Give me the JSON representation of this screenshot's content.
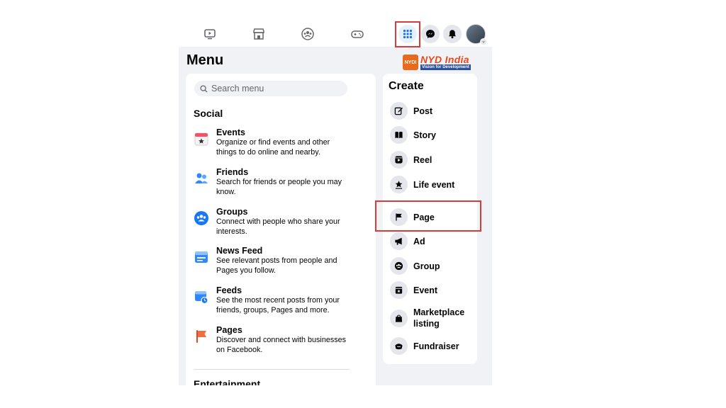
{
  "colors": {
    "accent": "#1877f2",
    "highlight": "#d93a3a",
    "background": "#f0f2f5"
  },
  "topbar": {
    "icons": [
      "watch-icon",
      "marketplace-icon",
      "groups-icon",
      "gaming-icon",
      "menu-grid-icon",
      "messenger-icon",
      "notifications-icon"
    ]
  },
  "logo": {
    "badge": "NYDI",
    "main": "NYD India",
    "sub": "Vision for Development"
  },
  "menu": {
    "title": "Menu",
    "search_placeholder": "Search menu",
    "social_title": "Social",
    "items": [
      {
        "label": "Events",
        "desc": "Organize or find events and other things to do online and nearby.",
        "icon": "events-icon"
      },
      {
        "label": "Friends",
        "desc": "Search for friends or people you may know.",
        "icon": "friends-icon"
      },
      {
        "label": "Groups",
        "desc": "Connect with people who share your interests.",
        "icon": "groups-icon"
      },
      {
        "label": "News Feed",
        "desc": "See relevant posts from people and Pages you follow.",
        "icon": "news-feed-icon"
      },
      {
        "label": "Feeds",
        "desc": "See the most recent posts from your friends, groups, Pages and more.",
        "icon": "feeds-icon"
      },
      {
        "label": "Pages",
        "desc": "Discover and connect with businesses on Facebook.",
        "icon": "pages-flag-icon"
      }
    ],
    "entertainment_title": "Entertainment"
  },
  "create": {
    "title": "Create",
    "items": [
      {
        "label": "Post",
        "icon": "post-icon"
      },
      {
        "label": "Story",
        "icon": "story-icon"
      },
      {
        "label": "Reel",
        "icon": "reel-icon"
      },
      {
        "label": "Life event",
        "icon": "life-event-icon"
      },
      {
        "label": "Page",
        "icon": "page-flag-icon"
      },
      {
        "label": "Ad",
        "icon": "ad-megaphone-icon"
      },
      {
        "label": "Group",
        "icon": "group-icon"
      },
      {
        "label": "Event",
        "icon": "event-icon"
      },
      {
        "label": "Marketplace listing",
        "icon": "marketplace-bag-icon"
      },
      {
        "label": "Fundraiser",
        "icon": "fundraiser-icon"
      }
    ]
  }
}
